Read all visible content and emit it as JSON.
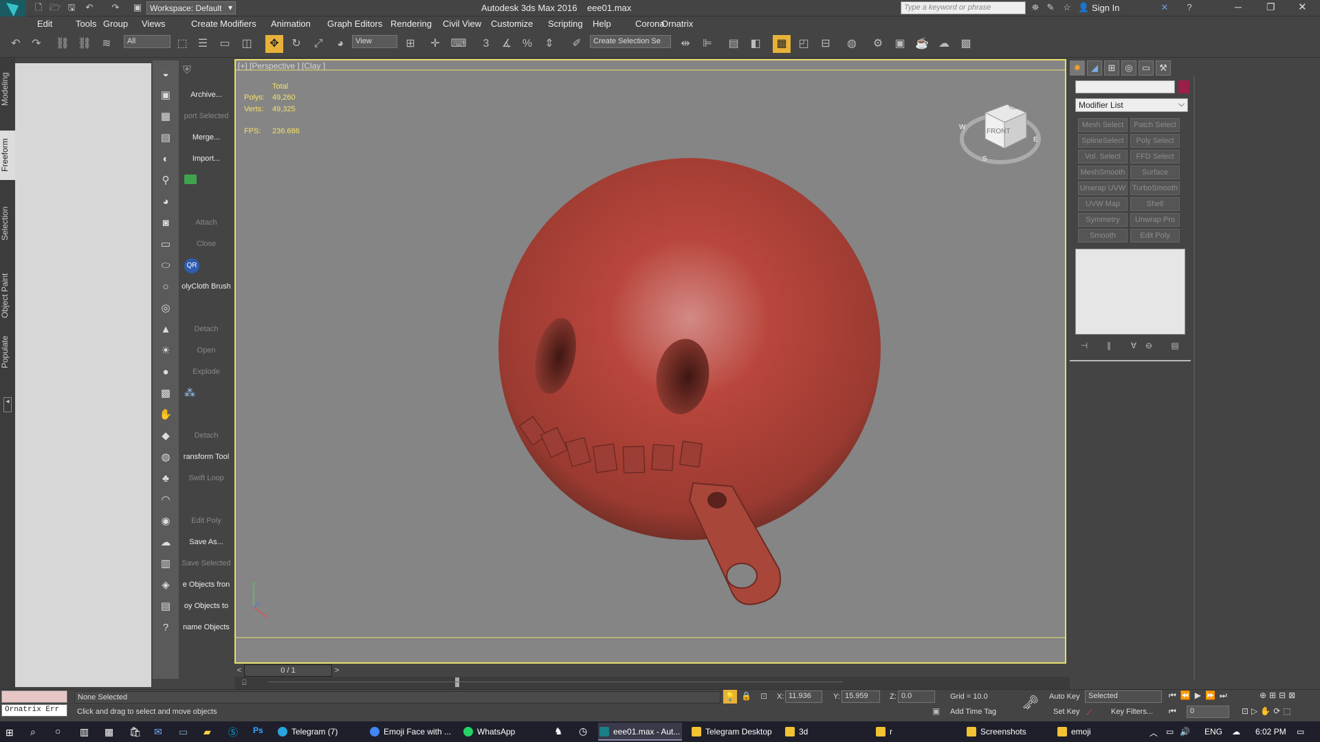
{
  "window": {
    "app_title": "Autodesk 3ds Max 2016",
    "file_name": "eee01.max",
    "workspace": "Workspace: Default",
    "search_placeholder": "Type a keyword or phrase",
    "sign_in": "Sign In",
    "logo_text": "MAX"
  },
  "menu": [
    "Edit",
    "Tools",
    "Group",
    "Views",
    "Create",
    "Modifiers",
    "Animation",
    "Graph Editors",
    "Rendering",
    "Civil View",
    "Customize",
    "Scripting",
    "Help",
    "Corona",
    "Ornatrix"
  ],
  "toolbar": {
    "selection_filter": "All",
    "ref_coord": "View",
    "named_selection": "Create Selection Se"
  },
  "ribbon_tabs": [
    "Modeling",
    "Freeform",
    "Selection",
    "Object Paint",
    "Populate"
  ],
  "ribbon_selected": "Freeform",
  "script_labels": [
    {
      "t": "Archive...",
      "dim": false
    },
    {
      "t": "port Selected",
      "dim": true
    },
    {
      "t": "Merge...",
      "dim": false
    },
    {
      "t": "Import...",
      "dim": false
    },
    {
      "t": "",
      "dim": false
    },
    {
      "t": "",
      "dim": false
    },
    {
      "t": "Attach",
      "dim": true
    },
    {
      "t": "Close",
      "dim": true
    },
    {
      "t": "",
      "dim": false
    },
    {
      "t": "olyCloth Brush",
      "dim": false
    },
    {
      "t": "",
      "dim": false
    },
    {
      "t": "Detach",
      "dim": true
    },
    {
      "t": "Open",
      "dim": true
    },
    {
      "t": "Explode",
      "dim": true
    },
    {
      "t": "",
      "dim": false
    },
    {
      "t": "",
      "dim": false
    },
    {
      "t": "Detach",
      "dim": true
    },
    {
      "t": "ransform Tool",
      "dim": false
    },
    {
      "t": "Swift Loop",
      "dim": true
    },
    {
      "t": "",
      "dim": false
    },
    {
      "t": "Edit Poly",
      "dim": true
    },
    {
      "t": "Save As...",
      "dim": false
    },
    {
      "t": "Save Selected",
      "dim": true
    },
    {
      "t": "e Objects fron",
      "dim": false
    },
    {
      "t": "oy Objects to",
      "dim": false
    },
    {
      "t": "name Objects",
      "dim": false
    }
  ],
  "viewport": {
    "label": "[+] [Perspective ] [Clay ]",
    "stats": {
      "total_label": "Total",
      "polys_label": "Polys:",
      "polys": "49,260",
      "verts_label": "Verts:",
      "verts": "49,325",
      "fps_label": "FPS:",
      "fps": "236.686"
    },
    "viewcube": {
      "top": "TOP",
      "front": "FRONT",
      "south": "S",
      "east": "E",
      "west": "W"
    }
  },
  "command_panel": {
    "modifier_list": "Modifier List",
    "modifier_buttons": [
      "Mesh Select",
      "Patch Select",
      "SplineSelect",
      "Poly Select",
      "Vol. Select",
      "FFD Select",
      "MeshSmooth",
      "Surface Select",
      "Unwrap UVW",
      "TurboSmooth",
      "UVW Map",
      "Shell",
      "Symmetry",
      "Unwrap Pro",
      "Smooth",
      "Edit Poly"
    ]
  },
  "timeline": {
    "frame": "0 / 1"
  },
  "status": {
    "maxscript": "Ornatrix Err",
    "selection": "None Selected",
    "prompt": "Click and drag to select and move objects",
    "x_label": "X:",
    "x": "11.936",
    "y_label": "Y:",
    "y": "15.959",
    "z_label": "Z:",
    "z": "0.0",
    "grid": "Grid = 10.0",
    "add_time_tag": "Add Time Tag",
    "auto_key": "Auto Key",
    "set_key": "Set Key",
    "key_mode": "Selected",
    "key_filters": "Key Filters...",
    "frame_field": "0"
  },
  "taskbar": {
    "items": [
      {
        "label": "Telegram (7)",
        "cls": "tg"
      },
      {
        "label": "Emoji Face with ...",
        "cls": "ch"
      },
      {
        "label": "WhatsApp",
        "cls": "wa"
      },
      {
        "label": "eee01.max - Aut...",
        "cls": "mx"
      },
      {
        "label": "Telegram Desktop",
        "cls": ""
      },
      {
        "label": "3d",
        "cls": ""
      },
      {
        "label": "r",
        "cls": ""
      },
      {
        "label": "Screenshots",
        "cls": ""
      },
      {
        "label": "emoji",
        "cls": ""
      }
    ],
    "lang": "ENG",
    "time": "6:02 PM"
  },
  "colors": {
    "accent": "#e8b23a",
    "viewport_border": "#e7e06b",
    "model": "#b2433a"
  }
}
